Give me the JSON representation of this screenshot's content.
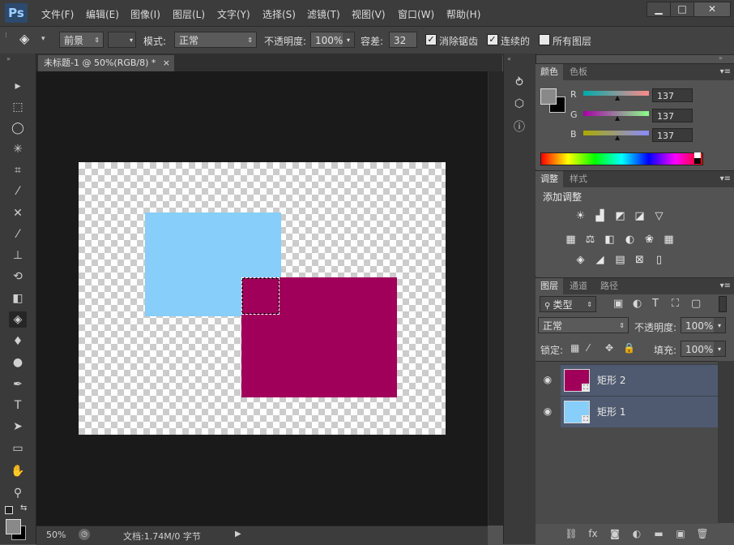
{
  "app": {
    "logo": "Ps"
  },
  "menu": [
    "文件(F)",
    "编辑(E)",
    "图像(I)",
    "图层(L)",
    "文字(Y)",
    "选择(S)",
    "滤镜(T)",
    "视图(V)",
    "窗口(W)",
    "帮助(H)"
  ],
  "window_controls": {
    "minimize": "▁",
    "maximize": "□",
    "close": "✕"
  },
  "options": {
    "fill_source": "前景",
    "mode_label": "模式:",
    "mode_value": "正常",
    "opacity_label": "不透明度:",
    "opacity_value": "100%",
    "tolerance_label": "容差:",
    "tolerance_value": "32",
    "antialias_label": "消除锯齿",
    "contiguous_label": "连续的",
    "all_layers_label": "所有图层",
    "antialias_checked": true,
    "contiguous_checked": true,
    "all_layers_checked": false
  },
  "document": {
    "tab_title": "未标题-1 @ 50%(RGB/8) *",
    "tab_close": "×",
    "zoom": "50%",
    "doc_info": "文档:1.74M/0 字节",
    "canvas_shapes": [
      {
        "name": "矩形 1",
        "color": "#87cefa"
      },
      {
        "name": "矩形 2",
        "color": "#a0005a"
      }
    ]
  },
  "tools": [
    {
      "name": "move-tool-icon",
      "glyph": "▸"
    },
    {
      "name": "marquee-tool-icon",
      "glyph": "⬚"
    },
    {
      "name": "lasso-tool-icon",
      "glyph": "◯"
    },
    {
      "name": "magic-wand-tool-icon",
      "glyph": "✳"
    },
    {
      "name": "crop-tool-icon",
      "glyph": "⌗"
    },
    {
      "name": "eyedropper-tool-icon",
      "glyph": "⁄"
    },
    {
      "name": "healing-brush-tool-icon",
      "glyph": "✕"
    },
    {
      "name": "brush-tool-icon",
      "glyph": "⁄"
    },
    {
      "name": "clone-stamp-tool-icon",
      "glyph": "⊥"
    },
    {
      "name": "history-brush-tool-icon",
      "glyph": "⟲"
    },
    {
      "name": "eraser-tool-icon",
      "glyph": "◧"
    },
    {
      "name": "paint-bucket-tool-icon",
      "glyph": "◈",
      "selected": true
    },
    {
      "name": "blur-tool-icon",
      "glyph": "♦"
    },
    {
      "name": "dodge-tool-icon",
      "glyph": "●"
    },
    {
      "name": "pen-tool-icon",
      "glyph": "✒"
    },
    {
      "name": "type-tool-icon",
      "glyph": "T"
    },
    {
      "name": "path-selection-tool-icon",
      "glyph": "➤"
    },
    {
      "name": "rectangle-tool-icon",
      "glyph": "▭"
    },
    {
      "name": "hand-tool-icon",
      "glyph": "✋"
    },
    {
      "name": "zoom-tool-icon",
      "glyph": "⚲"
    }
  ],
  "colors": {
    "foreground": "#898989",
    "background": "#000000"
  },
  "color_panel": {
    "tabs": [
      "颜色",
      "色板"
    ],
    "channels": [
      {
        "label": "R",
        "value": "137"
      },
      {
        "label": "G",
        "value": "137"
      },
      {
        "label": "B",
        "value": "137"
      }
    ]
  },
  "adjust_panel": {
    "tabs": [
      "调整",
      "样式"
    ],
    "title": "添加调整",
    "row1": [
      "☀",
      "▟",
      "◩",
      "◪",
      "▽"
    ],
    "row2": [
      "▦",
      "⚖",
      "◧",
      "◐",
      "❀",
      "▦"
    ],
    "row3": [
      "◈",
      "◢",
      "▤",
      "⊠",
      "▯"
    ]
  },
  "layers_panel": {
    "tabs": [
      "图层",
      "通道",
      "路径"
    ],
    "filter": "类型",
    "filter_icons": [
      "▣",
      "◐",
      "T",
      "⛶",
      "▢"
    ],
    "blend_mode": "正常",
    "opacity_label": "不透明度:",
    "opacity_value": "100%",
    "lock_label": "锁定:",
    "fill_label": "填充:",
    "fill_value": "100%",
    "layers": [
      {
        "name": "矩形 2",
        "color": "#a0005a",
        "visible_glyph": "👁"
      },
      {
        "name": "矩形 1",
        "color": "#87cefa",
        "visible_glyph": "👁"
      }
    ],
    "bottom_icons": [
      "⛓",
      "fx",
      "◙",
      "◐",
      "▬",
      "▣",
      "🗑"
    ]
  },
  "dock_icons": [
    "history-icon",
    "3d-icon",
    "info-icon"
  ]
}
